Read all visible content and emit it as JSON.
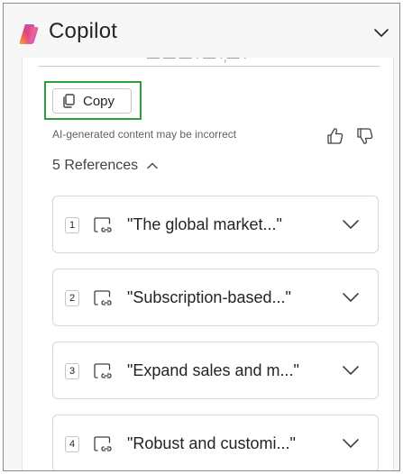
{
  "header": {
    "title": "Copilot",
    "logo_icon": "copilot-logo-icon",
    "collapse_icon": "chevron-down-icon"
  },
  "response": {
    "copy_label": "Copy",
    "copy_icon": "copy-icon",
    "disclaimer": "AI-generated content may be incorrect",
    "like_icon": "thumb-up-icon",
    "dislike_icon": "thumb-down-icon"
  },
  "references": {
    "label": "5 References",
    "toggle_icon": "chevron-up-icon",
    "items": [
      {
        "number": "1",
        "text": "\"The global market...\""
      },
      {
        "number": "2",
        "text": "\"Subscription-based...\""
      },
      {
        "number": "3",
        "text": "\"Expand sales and m...\""
      },
      {
        "number": "4",
        "text": "\"Robust and customi...\""
      }
    ]
  },
  "colors": {
    "highlight": "#2e9e3a",
    "panel_bg": "#f7f7f7",
    "card_border": "#d6d6d6"
  }
}
